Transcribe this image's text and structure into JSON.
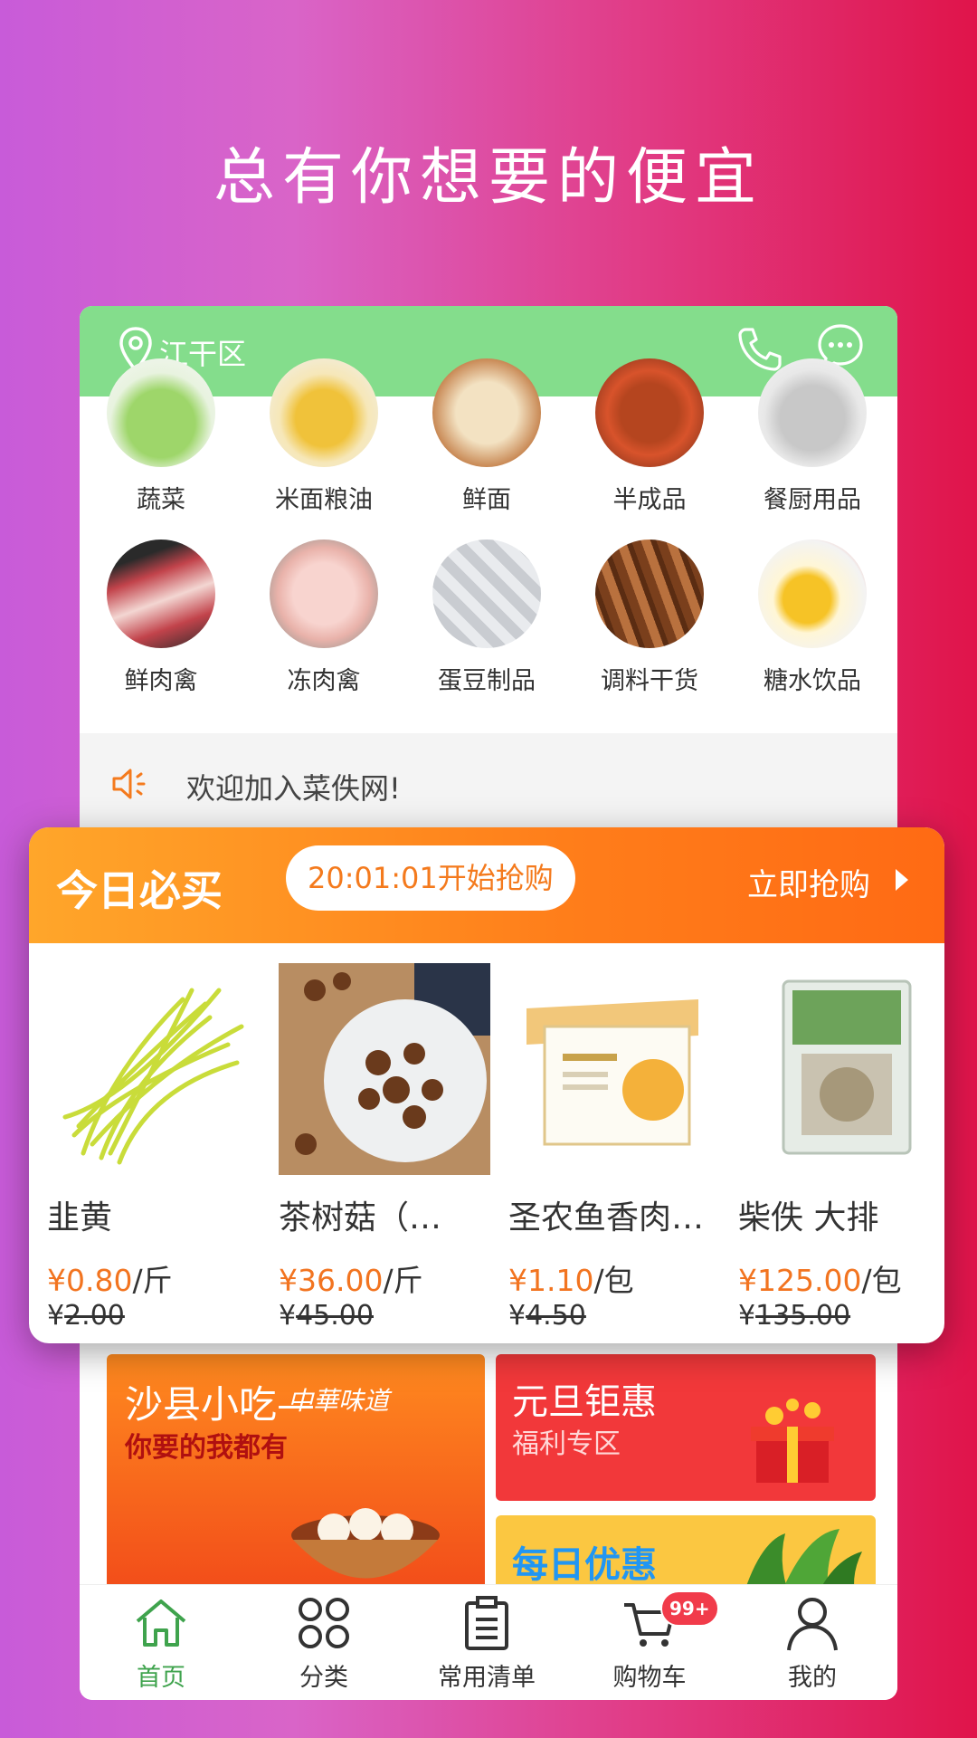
{
  "headline": "总有你想要的便宜",
  "appbar": {
    "location": "江干区"
  },
  "categories": [
    "蔬菜",
    "米面粮油",
    "鲜面",
    "半成品",
    "餐厨用品",
    "鲜肉禽",
    "冻肉禽",
    "蛋豆制品",
    "调料干货",
    "糖水饮品"
  ],
  "notice": "欢迎加入菜佚网!",
  "deal": {
    "title": "今日必买",
    "countdown": "20:01:01开始抢购",
    "go_label": "立即抢购",
    "products": [
      {
        "name": "韭黄",
        "currency": "¥",
        "price": "0.80",
        "unit": "/斤",
        "old_price": "2.00"
      },
      {
        "name": "茶树菇（…",
        "currency": "¥",
        "price": "36.00",
        "unit": "/斤",
        "old_price": "45.00"
      },
      {
        "name": "圣农鱼香肉…",
        "currency": "¥",
        "price": "1.10",
        "unit": "/包",
        "old_price": "4.50"
      },
      {
        "name": "柴佚 大排",
        "currency": "¥",
        "price": "125.00",
        "unit": "/包",
        "old_price": "135.00"
      }
    ]
  },
  "promos": {
    "left_title": "沙县小吃—",
    "left_tag": "中華味道",
    "left_sub": "你要的我都有",
    "right_top_title": "元旦钜惠",
    "right_top_sub": "福利专区",
    "right_bottom_title": "每日优惠"
  },
  "tabs": [
    {
      "label": "首页",
      "icon": "home-icon",
      "active": true
    },
    {
      "label": "分类",
      "icon": "grid-icon",
      "active": false
    },
    {
      "label": "常用清单",
      "icon": "clipboard-icon",
      "active": false
    },
    {
      "label": "购物车",
      "icon": "cart-icon",
      "active": false,
      "badge": "99+"
    },
    {
      "label": "我的",
      "icon": "user-icon",
      "active": false
    }
  ],
  "colors": {
    "appbar": "#84dd8c",
    "accent_orange": "#ff7d1a",
    "price": "#f27420",
    "active_tab": "#3fa34d"
  }
}
